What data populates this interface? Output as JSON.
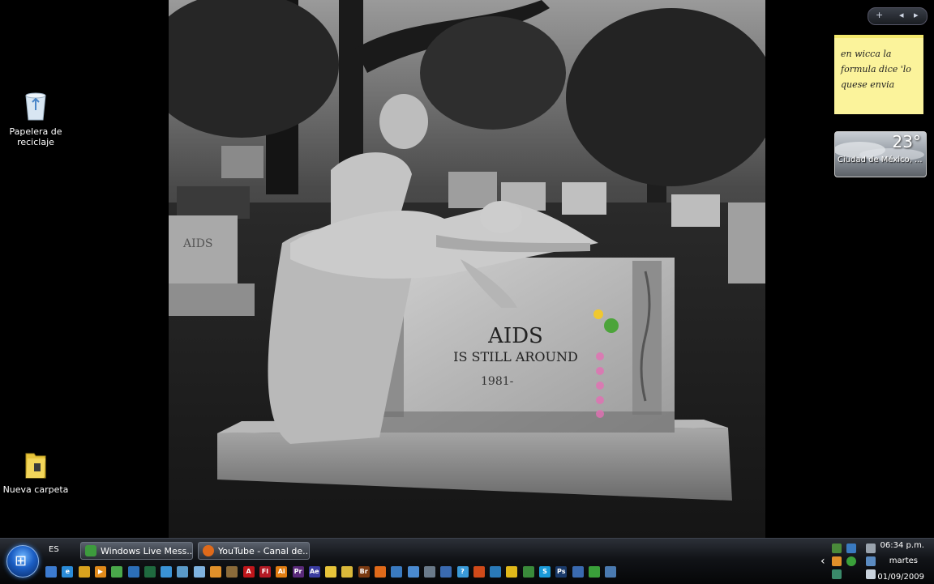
{
  "desktop": {
    "icons": [
      {
        "label": "Papelera de\nreciclaje",
        "icon": "recycle-bin-icon"
      },
      {
        "label": "Nueva carpeta",
        "icon": "folder-icon"
      }
    ]
  },
  "wallpaper": {
    "headline": "AIDS",
    "subline": "IS STILL AROUND",
    "year": "1981-",
    "side_stone_text": "AIDS"
  },
  "gadgets": {
    "controls": {
      "add": "+",
      "prev": "◂",
      "next": "▸"
    },
    "note_text": "en wicca la\nformula dice 'lo\nquese envia",
    "weather": {
      "temperature": "23°",
      "city": "Ciudad de México, ..."
    }
  },
  "taskbar": {
    "language": "ES",
    "tasks": [
      {
        "label": "Windows Live Mess...",
        "icon": "messenger-icon"
      },
      {
        "label": "YouTube - Canal de...",
        "icon": "firefox-icon"
      }
    ],
    "quick_launch": [
      {
        "icon": "show-desktop-icon",
        "color": "#3c7bd0",
        "glyph": ""
      },
      {
        "icon": "internet-explorer-icon",
        "color": "#2a8bd8",
        "glyph": "e"
      },
      {
        "icon": "chrome-icon",
        "color": "#d9a21e",
        "glyph": ""
      },
      {
        "icon": "media-player-icon",
        "color": "#e08a1a",
        "glyph": "▶"
      },
      {
        "icon": "messenger-icon",
        "color": "#4aa84a",
        "glyph": ""
      },
      {
        "icon": "photos-icon",
        "color": "#2c6fb8",
        "glyph": ""
      },
      {
        "icon": "windows-media-center-icon",
        "color": "#1f6a3f",
        "glyph": ""
      },
      {
        "icon": "network-icon",
        "color": "#3a93d6",
        "glyph": ""
      },
      {
        "icon": "settings-icon",
        "color": "#5a9ac8",
        "glyph": ""
      },
      {
        "icon": "update-icon",
        "color": "#7fb3e0",
        "glyph": ""
      },
      {
        "icon": "package-icon",
        "color": "#e0902a",
        "glyph": ""
      },
      {
        "icon": "tool-icon",
        "color": "#8b6b3a",
        "glyph": ""
      },
      {
        "icon": "acrobat-icon",
        "color": "#c0161b",
        "glyph": "A"
      },
      {
        "icon": "flash-icon",
        "color": "#b21a24",
        "glyph": "Fl"
      },
      {
        "icon": "illustrator-icon",
        "color": "#e07d12",
        "glyph": "Ai"
      },
      {
        "icon": "premiere-icon",
        "color": "#5a2a7a",
        "glyph": "Pr"
      },
      {
        "icon": "after-effects-icon",
        "color": "#3a3ca0",
        "glyph": "Ae"
      },
      {
        "icon": "folder-icon",
        "color": "#e7c43a",
        "glyph": ""
      },
      {
        "icon": "folder-icon",
        "color": "#d9b83a",
        "glyph": ""
      },
      {
        "icon": "bridge-icon",
        "color": "#7a3a12",
        "glyph": "Br"
      },
      {
        "icon": "firefox-icon",
        "color": "#e06a1a",
        "glyph": ""
      },
      {
        "icon": "paint-icon",
        "color": "#3a7ac0",
        "glyph": ""
      },
      {
        "icon": "people-icon",
        "color": "#4a8ad0",
        "glyph": ""
      },
      {
        "icon": "calculator-icon",
        "color": "#6a7a8a",
        "glyph": ""
      },
      {
        "icon": "network-icon",
        "color": "#3a6ab0",
        "glyph": ""
      },
      {
        "icon": "help-icon",
        "color": "#3a9ad8",
        "glyph": "?"
      },
      {
        "icon": "download-icon",
        "color": "#d04a1a",
        "glyph": ""
      },
      {
        "icon": "gear-icon",
        "color": "#2a7ab8",
        "glyph": ""
      },
      {
        "icon": "pencil-icon",
        "color": "#e0b81a",
        "glyph": ""
      },
      {
        "icon": "messenger-icon",
        "color": "#3a8a3a",
        "glyph": ""
      },
      {
        "icon": "skype-icon",
        "color": "#1a9ad8",
        "glyph": "S"
      },
      {
        "icon": "photoshop-icon",
        "color": "#1a3a6a",
        "glyph": "Ps"
      },
      {
        "icon": "window-icon",
        "color": "#3a6ab0",
        "glyph": ""
      },
      {
        "icon": "recycle-icon",
        "color": "#3aa03a",
        "glyph": ""
      },
      {
        "icon": "screen-icon",
        "color": "#4a7ab0",
        "glyph": ""
      }
    ],
    "tray": {
      "time": "06:34 p.m.",
      "day": "martes",
      "date": "01/09/2009",
      "expand": "‹"
    }
  }
}
